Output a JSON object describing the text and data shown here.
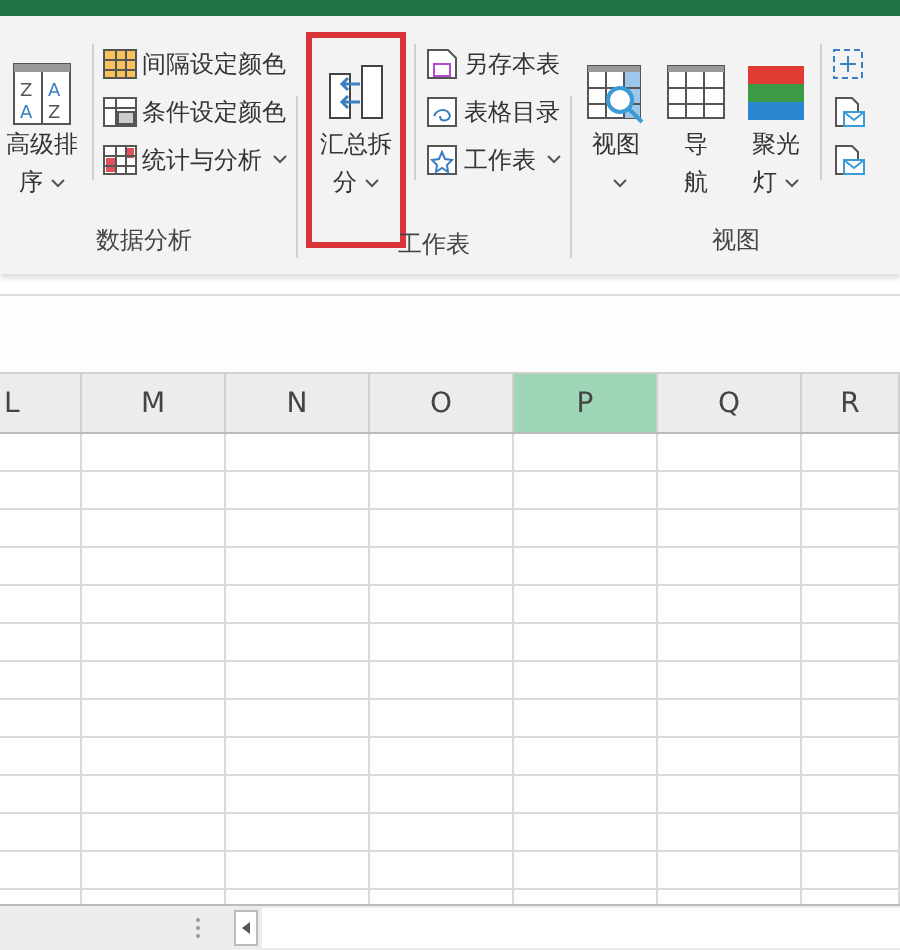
{
  "ribbon": {
    "groups": [
      {
        "label": "数据分析",
        "large": [
          {
            "kind": "sort",
            "icon_letters": [
              "Z",
              "A",
              "A",
              "Z"
            ],
            "lines": [
              "高级排",
              "序"
            ],
            "dropdown": true,
            "highlighted": false
          }
        ],
        "small": [
          {
            "kind": "stripes",
            "label": "间隔设定颜色",
            "dropdown": false
          },
          {
            "kind": "condition",
            "label": "条件设定颜色",
            "dropdown": false
          },
          {
            "kind": "stats",
            "label": "统计与分析",
            "dropdown": true
          }
        ]
      },
      {
        "label": "工作表",
        "large": [
          {
            "kind": "split",
            "lines": [
              "汇总拆",
              "分"
            ],
            "dropdown": true,
            "highlighted": true
          }
        ],
        "small": [
          {
            "kind": "save",
            "label": "另存本表",
            "dropdown": false
          },
          {
            "kind": "toc",
            "label": "表格目录",
            "dropdown": false
          },
          {
            "kind": "sheet",
            "label": "工作表",
            "dropdown": true
          }
        ]
      },
      {
        "label": "视图",
        "large": [
          {
            "kind": "view",
            "lines": [
              "视图"
            ],
            "dropdown": true,
            "highlighted": false
          },
          {
            "kind": "nav",
            "lines": [
              "导",
              "航"
            ],
            "dropdown": false,
            "highlighted": false
          },
          {
            "kind": "spotlight",
            "lines": [
              "聚光",
              "灯"
            ],
            "dropdown": true,
            "highlighted": false
          }
        ],
        "small": [
          {
            "kind": "fit"
          },
          {
            "kind": "mail"
          },
          {
            "kind": "mail"
          }
        ]
      }
    ]
  },
  "sheet": {
    "columns": [
      {
        "label": "L",
        "selected": false
      },
      {
        "label": "M",
        "selected": false
      },
      {
        "label": "N",
        "selected": false
      },
      {
        "label": "O",
        "selected": false
      },
      {
        "label": "P",
        "selected": true
      },
      {
        "label": "Q",
        "selected": false
      },
      {
        "label": "R",
        "selected": false
      }
    ]
  }
}
